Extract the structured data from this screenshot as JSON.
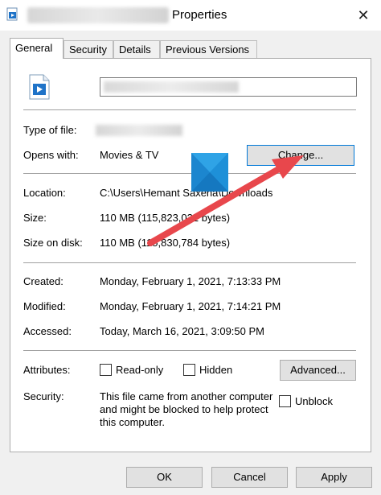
{
  "window": {
    "title": "Properties",
    "close_glyph": "✕"
  },
  "tabs": [
    {
      "label": "General"
    },
    {
      "label": "Security"
    },
    {
      "label": "Details"
    },
    {
      "label": "Previous Versions"
    }
  ],
  "general": {
    "type_label": "Type of file:",
    "opens_label": "Opens with:",
    "opens_value": "Movies & TV",
    "change_button": "Change...",
    "location_label": "Location:",
    "location_value": "C:\\Users\\Hemant Saxena\\Downloads",
    "size_label": "Size:",
    "size_value": "110 MB (115,823,022 bytes)",
    "size_on_disk_label": "Size on disk:",
    "size_on_disk_value": "110 MB (115,830,784 bytes)",
    "created_label": "Created:",
    "created_value": "Monday, February 1, 2021, 7:13:33 PM",
    "modified_label": "Modified:",
    "modified_value": "Monday, February 1, 2021, 7:14:21 PM",
    "accessed_label": "Accessed:",
    "accessed_value": "Today, March 16, 2021, 3:09:50 PM",
    "attributes_label": "Attributes:",
    "readonly_label": "Read-only",
    "hidden_label": "Hidden",
    "advanced_button": "Advanced...",
    "security_label": "Security:",
    "security_text": "This file came from another computer and might be blocked to help protect this computer.",
    "unblock_label": "Unblock"
  },
  "footer": {
    "ok": "OK",
    "cancel": "Cancel",
    "apply": "Apply"
  },
  "colors": {
    "arrow": "#e8474c",
    "focus_border": "#0078d7",
    "movies_tile": "#1e90d8"
  }
}
